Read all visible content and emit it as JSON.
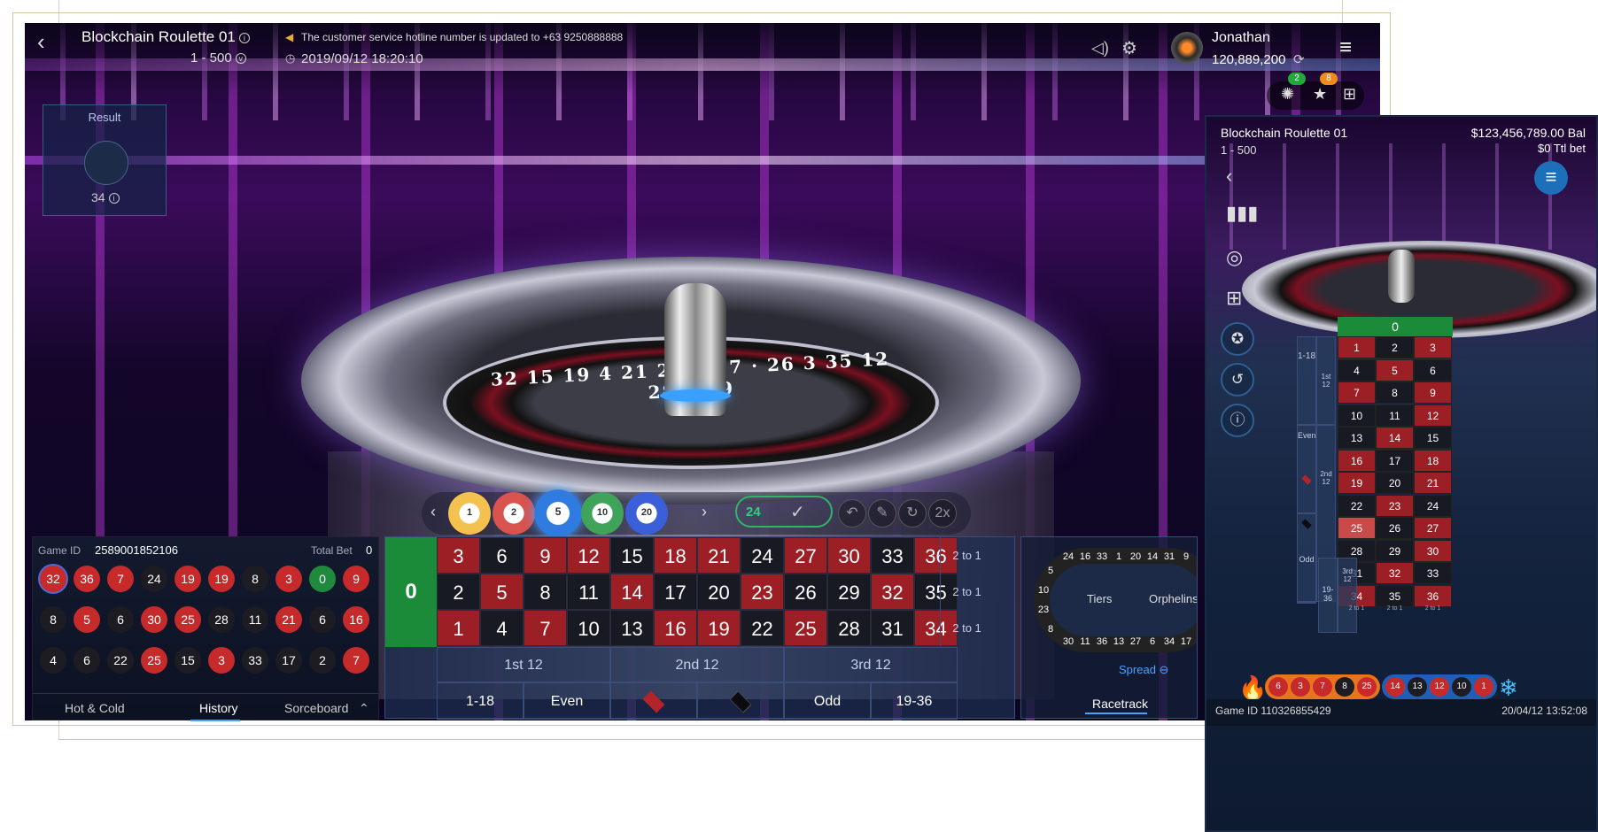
{
  "header": {
    "back_icon": "‹",
    "title": "Blockchain Roulette 01",
    "limit": "1 - 500",
    "notice": "The customer service hotline number is updated to +63 9250888888",
    "datetime": "2019/09/12 18:20:10",
    "username": "Jonathan",
    "balance": "120,889,200",
    "badge_green": "2",
    "badge_orange": "8"
  },
  "result": {
    "label": "Result",
    "number": "34"
  },
  "chips": [
    "1",
    "2",
    "5",
    "10",
    "20"
  ],
  "chip_count": "24",
  "bet_actions": [
    "↶",
    "✎",
    "↻",
    "2x"
  ],
  "history": {
    "game_id_label": "Game ID",
    "game_id": "2589001852106",
    "total_bet_label": "Total Bet",
    "total_bet": "0",
    "balls": [
      [
        "32",
        "r"
      ],
      [
        "36",
        "r"
      ],
      [
        "7",
        "r"
      ],
      [
        "24",
        "b"
      ],
      [
        "19",
        "r"
      ],
      [
        "19",
        "r"
      ],
      [
        "8",
        "b"
      ],
      [
        "3",
        "r"
      ],
      [
        "0",
        "g"
      ],
      [
        "9",
        "r"
      ],
      [
        "8",
        "b"
      ],
      [
        "5",
        "r"
      ],
      [
        "6",
        "b"
      ],
      [
        "30",
        "r"
      ],
      [
        "25",
        "r"
      ],
      [
        "28",
        "b"
      ],
      [
        "11",
        "b"
      ],
      [
        "21",
        "r"
      ],
      [
        "6",
        "b"
      ],
      [
        "16",
        "r"
      ],
      [
        "4",
        "b"
      ],
      [
        "6",
        "b"
      ],
      [
        "22",
        "b"
      ],
      [
        "25",
        "r"
      ],
      [
        "15",
        "b"
      ],
      [
        "3",
        "r"
      ],
      [
        "33",
        "b"
      ],
      [
        "17",
        "b"
      ],
      [
        "2",
        "b"
      ],
      [
        "7",
        "r"
      ]
    ],
    "tabs": [
      "Hot & Cold",
      "History",
      "Sorceboard"
    ]
  },
  "table": {
    "zero": "0",
    "rows": [
      [
        [
          "3",
          "r"
        ],
        [
          "6",
          "b"
        ],
        [
          "9",
          "r"
        ],
        [
          "12",
          "r"
        ],
        [
          "15",
          "b"
        ],
        [
          "18",
          "r"
        ],
        [
          "21",
          "r"
        ],
        [
          "24",
          "b"
        ],
        [
          "27",
          "r"
        ],
        [
          "30",
          "r"
        ],
        [
          "33",
          "b"
        ],
        [
          "36",
          "r"
        ]
      ],
      [
        [
          "2",
          "b"
        ],
        [
          "5",
          "r"
        ],
        [
          "8",
          "b"
        ],
        [
          "11",
          "b"
        ],
        [
          "14",
          "r"
        ],
        [
          "17",
          "b"
        ],
        [
          "20",
          "b"
        ],
        [
          "23",
          "r"
        ],
        [
          "26",
          "b"
        ],
        [
          "29",
          "b"
        ],
        [
          "32",
          "r"
        ],
        [
          "35",
          "b"
        ]
      ],
      [
        [
          "1",
          "r"
        ],
        [
          "4",
          "b"
        ],
        [
          "7",
          "r"
        ],
        [
          "10",
          "b"
        ],
        [
          "13",
          "b"
        ],
        [
          "16",
          "r"
        ],
        [
          "19",
          "r"
        ],
        [
          "22",
          "b"
        ],
        [
          "25",
          "r"
        ],
        [
          "28",
          "b"
        ],
        [
          "31",
          "b"
        ],
        [
          "34",
          "r"
        ]
      ]
    ],
    "columns": [
      "2 to 1",
      "2 to 1",
      "2 to 1"
    ],
    "dozens": [
      "1st 12",
      "2nd 12",
      "3rd 12"
    ],
    "outside": [
      "1-18",
      "Even",
      "",
      "",
      "Odd",
      "19-36"
    ]
  },
  "racetrack": {
    "tiers": "Tiers",
    "orphelins": "Orphelins",
    "spread": "Spread",
    "tab": "Racetrack",
    "top_numbers": [
      "24",
      "16",
      "33",
      "1",
      "20",
      "14",
      "31",
      "9"
    ],
    "bottom_numbers": [
      "30",
      "11",
      "36",
      "13",
      "27",
      "6",
      "34",
      "17"
    ],
    "left_numbers": [
      "5",
      "10",
      "23",
      "8"
    ]
  },
  "mobile": {
    "title": "Blockchain Roulette 01",
    "limit": "1 - 500",
    "balance": "$123,456,789.00 Bal",
    "total_bet": "$0 Ttl bet",
    "zero": "0",
    "grid": [
      [
        [
          "1",
          "r"
        ],
        [
          "2",
          "b"
        ],
        [
          "3",
          "r"
        ]
      ],
      [
        [
          "4",
          "b"
        ],
        [
          "5",
          "r"
        ],
        [
          "6",
          "b"
        ]
      ],
      [
        [
          "7",
          "r"
        ],
        [
          "8",
          "b"
        ],
        [
          "9",
          "r"
        ]
      ],
      [
        [
          "10",
          "b"
        ],
        [
          "11",
          "b"
        ],
        [
          "12",
          "r"
        ]
      ],
      [
        [
          "13",
          "b"
        ],
        [
          "14",
          "r"
        ],
        [
          "15",
          "b"
        ]
      ],
      [
        [
          "16",
          "r"
        ],
        [
          "17",
          "b"
        ],
        [
          "18",
          "r"
        ]
      ],
      [
        [
          "19",
          "r"
        ],
        [
          "20",
          "b"
        ],
        [
          "21",
          "r"
        ]
      ],
      [
        [
          "22",
          "b"
        ],
        [
          "23",
          "r"
        ],
        [
          "24",
          "b"
        ]
      ],
      [
        [
          "25",
          "hl"
        ],
        [
          "26",
          "b"
        ],
        [
          "27",
          "r"
        ]
      ],
      [
        [
          "28",
          "b"
        ],
        [
          "29",
          "b"
        ],
        [
          "30",
          "r"
        ]
      ],
      [
        [
          "31",
          "b"
        ],
        [
          "32",
          "r"
        ],
        [
          "33",
          "b"
        ]
      ],
      [
        [
          "34",
          "r"
        ],
        [
          "35",
          "b"
        ],
        [
          "36",
          "r"
        ]
      ]
    ],
    "left_labels": [
      "1-18",
      "1st 12",
      "Even",
      "2nd 12",
      "Odd",
      "3rd 12",
      "19-36"
    ],
    "footer": [
      "2 to 1",
      "2 to 1",
      "2 to 1"
    ],
    "hot": [
      [
        "6",
        "r"
      ],
      [
        "3",
        "r"
      ],
      [
        "7",
        "r"
      ],
      [
        "8",
        "b"
      ],
      [
        "25",
        "r"
      ]
    ],
    "cold": [
      [
        "14",
        "r"
      ],
      [
        "13",
        "b"
      ],
      [
        "12",
        "r"
      ],
      [
        "10",
        "b"
      ],
      [
        "1",
        "r"
      ]
    ],
    "game_id": "Game ID 110326855429",
    "datetime": "20/04/12 13:52:08"
  },
  "colors": {
    "red": "#9c1f25",
    "black": "#171a22",
    "green": "#1b8a39",
    "accent_blue": "#4aa3ff"
  }
}
